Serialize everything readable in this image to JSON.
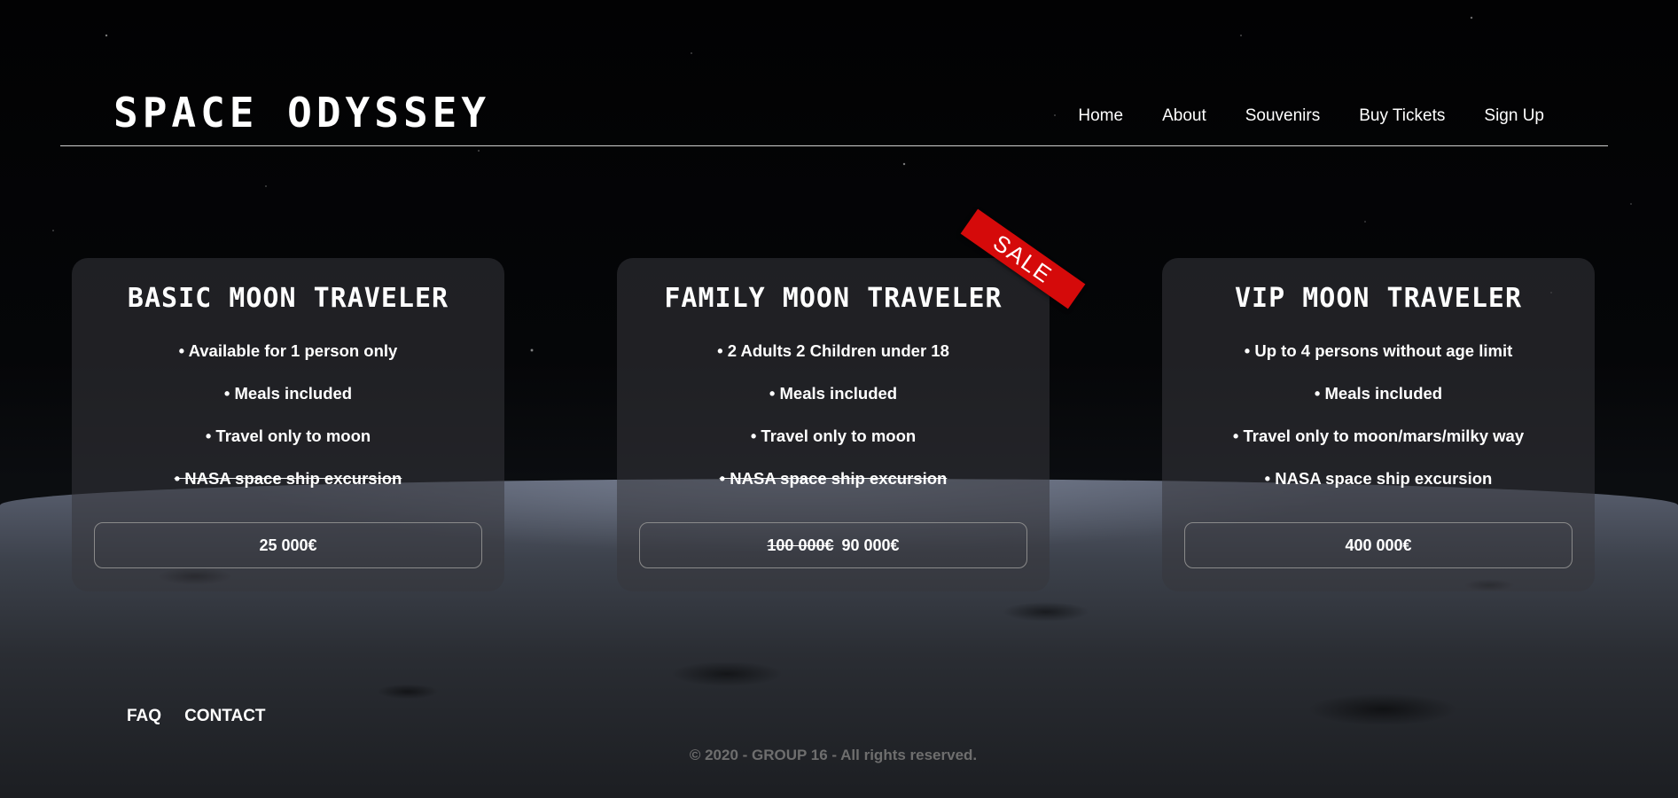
{
  "header": {
    "logo": "SPACE ODYSSEY",
    "nav": [
      "Home",
      "About",
      "Souvenirs",
      "Buy Tickets",
      "Sign Up"
    ]
  },
  "cards": [
    {
      "title": "BASIC MOON TRAVELER",
      "features": [
        "• Available for 1 person only",
        "• Meals included",
        "• Travel only to moon",
        "• NASA space ship excursion"
      ],
      "price": "25 000€"
    },
    {
      "title": "FAMILY MOON TRAVELER",
      "ribbon": "SALE",
      "features": [
        "• 2 Adults 2 Children under 18",
        "• Meals included",
        "• Travel only to moon",
        "• NASA space ship excursion"
      ],
      "old_price": "100 000€",
      "price": "90 000€"
    },
    {
      "title": "VIP MOON TRAVELER",
      "features": [
        "• Up to 4 persons without age limit",
        "• Meals included",
        "• Travel only to moon/mars/milky way",
        "• NASA space ship excursion"
      ],
      "price": "400 000€"
    }
  ],
  "footer": {
    "links": [
      "FAQ",
      "CONTACT"
    ],
    "copyright": "© 2020 - GROUP 16 - All rights reserved."
  },
  "colors": {
    "ribbon": "#d50a0a",
    "card_bg": "rgba(55,55,60,0.55)",
    "copyright": "#6e6e6e"
  }
}
